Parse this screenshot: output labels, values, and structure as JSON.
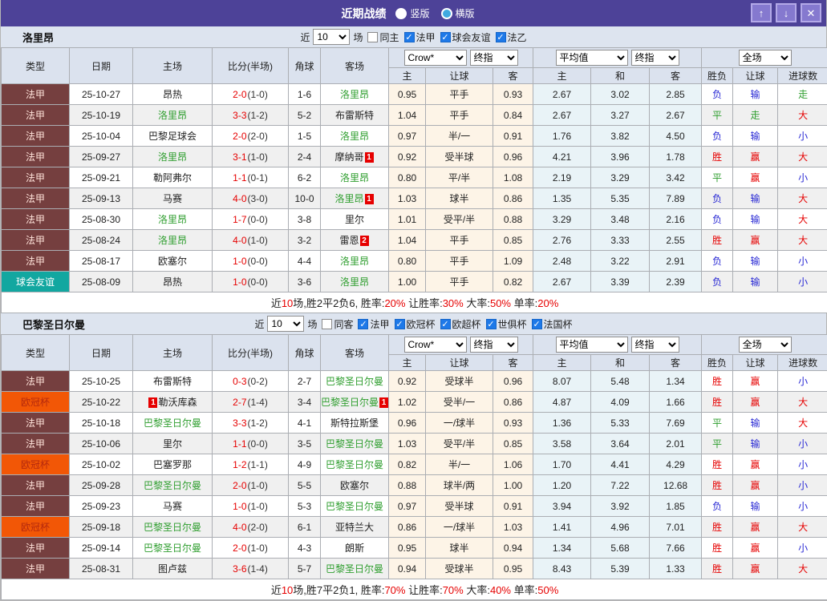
{
  "titlebar": {
    "title": "近期战绩",
    "radios": [
      {
        "label": "竖版",
        "selected": true
      },
      {
        "label": "横版",
        "selected": false
      }
    ],
    "buttons": {
      "up": "↑",
      "down": "↓",
      "close": "✕"
    }
  },
  "glyphs": {
    "check": "✓"
  },
  "colors": {
    "titlebar_bg": "#4d4298",
    "header_bg": "#dbe2ee",
    "handicap_col_bg": "#fdf4e7",
    "avg_col_bg": "#e9f3f7",
    "win_red": "#e60000",
    "draw_green": "#2f9e2f",
    "lose_blue": "#2727d4"
  },
  "type_styles": {
    "法甲": {
      "bg": "#753f3f",
      "fg": "#ffe3da"
    },
    "球会友谊": {
      "bg": "#12a7a0",
      "fg": "#ffffff"
    },
    "欧冠杯": {
      "bg": "#f25706",
      "fg": "#b5290e"
    }
  },
  "header_labels": {
    "type": "类型",
    "date": "日期",
    "home": "主场",
    "score": "比分(半场)",
    "corner": "角球",
    "away": "客场",
    "odds_select": "Crow*",
    "odds_select2": "终指",
    "avg_select": "平均值",
    "avg_select2": "终指",
    "result_select": "全场",
    "odds_sub": [
      "主",
      "让球",
      "客"
    ],
    "avg_sub": [
      "主",
      "和",
      "客"
    ],
    "result_sub": [
      "胜负",
      "让球",
      "进球数"
    ]
  },
  "sections": [
    {
      "team": "洛里昂",
      "filter": {
        "pre": "近",
        "count": "10",
        "post": "场",
        "same": {
          "label": "同主",
          "checked": false
        },
        "leagues": [
          {
            "label": "法甲",
            "checked": true
          },
          {
            "label": "球会友谊",
            "checked": true
          },
          {
            "label": "法乙",
            "checked": true
          }
        ]
      },
      "rows": [
        {
          "type": "法甲",
          "date": "25-10-27",
          "home": "昂热",
          "home_green": false,
          "ft": "2-0",
          "ht": "(1-0)",
          "corner": "1-6",
          "away": "洛里昂",
          "away_green": true,
          "odds": [
            "0.95",
            "平手",
            "0.93"
          ],
          "avg": [
            "2.67",
            "3.02",
            "2.85"
          ],
          "res": [
            [
              "负",
              "b"
            ],
            [
              "输",
              "b"
            ],
            [
              "走",
              "g"
            ]
          ]
        },
        {
          "type": "法甲",
          "date": "25-10-19",
          "home": "洛里昂",
          "home_green": true,
          "ft": "3-3",
          "ht": "(1-2)",
          "corner": "5-2",
          "away": "布雷斯特",
          "away_green": false,
          "odds": [
            "1.04",
            "平手",
            "0.84"
          ],
          "avg": [
            "2.67",
            "3.27",
            "2.67"
          ],
          "res": [
            [
              "平",
              "g"
            ],
            [
              "走",
              "g"
            ],
            [
              "大",
              "r"
            ]
          ]
        },
        {
          "type": "法甲",
          "date": "25-10-04",
          "home": "巴黎足球会",
          "home_green": false,
          "ft": "2-0",
          "ht": "(2-0)",
          "corner": "1-5",
          "away": "洛里昂",
          "away_green": true,
          "odds": [
            "0.97",
            "半/一",
            "0.91"
          ],
          "avg": [
            "1.76",
            "3.82",
            "4.50"
          ],
          "res": [
            [
              "负",
              "b"
            ],
            [
              "输",
              "b"
            ],
            [
              "小",
              "b"
            ]
          ]
        },
        {
          "type": "法甲",
          "date": "25-09-27",
          "home": "洛里昂",
          "home_green": true,
          "ft": "3-1",
          "ht": "(1-0)",
          "corner": "2-4",
          "away": "摩纳哥",
          "away_green": false,
          "away_badge_post": "1",
          "odds": [
            "0.92",
            "受半球",
            "0.96"
          ],
          "avg": [
            "4.21",
            "3.96",
            "1.78"
          ],
          "res": [
            [
              "胜",
              "r"
            ],
            [
              "赢",
              "r"
            ],
            [
              "大",
              "r"
            ]
          ]
        },
        {
          "type": "法甲",
          "date": "25-09-21",
          "home": "勒阿弗尔",
          "home_green": false,
          "ft": "1-1",
          "ht": "(0-1)",
          "corner": "6-2",
          "away": "洛里昂",
          "away_green": true,
          "odds": [
            "0.80",
            "平/半",
            "1.08"
          ],
          "avg": [
            "2.19",
            "3.29",
            "3.42"
          ],
          "res": [
            [
              "平",
              "g"
            ],
            [
              "赢",
              "r"
            ],
            [
              "小",
              "b"
            ]
          ]
        },
        {
          "type": "法甲",
          "date": "25-09-13",
          "home": "马赛",
          "home_green": false,
          "ft": "4-0",
          "ht": "(3-0)",
          "corner": "10-0",
          "away": "洛里昂",
          "away_green": true,
          "away_badge_post": "1",
          "odds": [
            "1.03",
            "球半",
            "0.86"
          ],
          "avg": [
            "1.35",
            "5.35",
            "7.89"
          ],
          "res": [
            [
              "负",
              "b"
            ],
            [
              "输",
              "b"
            ],
            [
              "大",
              "r"
            ]
          ]
        },
        {
          "type": "法甲",
          "date": "25-08-30",
          "home": "洛里昂",
          "home_green": true,
          "ft": "1-7",
          "ht": "(0-0)",
          "corner": "3-8",
          "away": "里尔",
          "away_green": false,
          "odds": [
            "1.01",
            "受平/半",
            "0.88"
          ],
          "avg": [
            "3.29",
            "3.48",
            "2.16"
          ],
          "res": [
            [
              "负",
              "b"
            ],
            [
              "输",
              "b"
            ],
            [
              "大",
              "r"
            ]
          ]
        },
        {
          "type": "法甲",
          "date": "25-08-24",
          "home": "洛里昂",
          "home_green": true,
          "ft": "4-0",
          "ht": "(1-0)",
          "corner": "3-2",
          "away": "雷恩",
          "away_green": false,
          "away_badge_post": "2",
          "odds": [
            "1.04",
            "平手",
            "0.85"
          ],
          "avg": [
            "2.76",
            "3.33",
            "2.55"
          ],
          "res": [
            [
              "胜",
              "r"
            ],
            [
              "赢",
              "r"
            ],
            [
              "大",
              "r"
            ]
          ]
        },
        {
          "type": "法甲",
          "date": "25-08-17",
          "home": "欧塞尔",
          "home_green": false,
          "ft": "1-0",
          "ht": "(0-0)",
          "corner": "4-4",
          "away": "洛里昂",
          "away_green": true,
          "odds": [
            "0.80",
            "平手",
            "1.09"
          ],
          "avg": [
            "2.48",
            "3.22",
            "2.91"
          ],
          "res": [
            [
              "负",
              "b"
            ],
            [
              "输",
              "b"
            ],
            [
              "小",
              "b"
            ]
          ]
        },
        {
          "type": "球会友谊",
          "date": "25-08-09",
          "home": "昂热",
          "home_green": false,
          "ft": "1-0",
          "ht": "(0-0)",
          "corner": "3-6",
          "away": "洛里昂",
          "away_green": true,
          "odds": [
            "1.00",
            "平手",
            "0.82"
          ],
          "avg": [
            "2.67",
            "3.39",
            "2.39"
          ],
          "res": [
            [
              "负",
              "b"
            ],
            [
              "输",
              "b"
            ],
            [
              "小",
              "b"
            ]
          ]
        }
      ],
      "summary": [
        [
          "近",
          "k"
        ],
        [
          "10",
          "r"
        ],
        [
          "场,胜2平2负6, 胜率:",
          "k"
        ],
        [
          "20%",
          "r"
        ],
        [
          " 让胜率:",
          "k"
        ],
        [
          "30%",
          "r"
        ],
        [
          " 大率:",
          "k"
        ],
        [
          "50%",
          "r"
        ],
        [
          " 单率:",
          "k"
        ],
        [
          "20%",
          "r"
        ]
      ]
    },
    {
      "team": "巴黎圣日尔曼",
      "filter": {
        "pre": "近",
        "count": "10",
        "post": "场",
        "same": {
          "label": "同客",
          "checked": false
        },
        "leagues": [
          {
            "label": "法甲",
            "checked": true
          },
          {
            "label": "欧冠杯",
            "checked": true
          },
          {
            "label": "欧超杯",
            "checked": true
          },
          {
            "label": "世俱杯",
            "checked": true
          },
          {
            "label": "法国杯",
            "checked": true
          }
        ]
      },
      "rows": [
        {
          "type": "法甲",
          "date": "25-10-25",
          "home": "布雷斯特",
          "home_green": false,
          "ft": "0-3",
          "ht": "(0-2)",
          "corner": "2-7",
          "away": "巴黎圣日尔曼",
          "away_green": true,
          "odds": [
            "0.92",
            "受球半",
            "0.96"
          ],
          "avg": [
            "8.07",
            "5.48",
            "1.34"
          ],
          "res": [
            [
              "胜",
              "r"
            ],
            [
              "赢",
              "r"
            ],
            [
              "小",
              "b"
            ]
          ]
        },
        {
          "type": "欧冠杯",
          "date": "25-10-22",
          "home": "勒沃库森",
          "home_green": false,
          "home_badge_pre": "1",
          "ft": "2-7",
          "ht": "(1-4)",
          "corner": "3-4",
          "away": "巴黎圣日尔曼",
          "away_green": true,
          "away_badge_post": "1",
          "odds": [
            "1.02",
            "受半/一",
            "0.86"
          ],
          "avg": [
            "4.87",
            "4.09",
            "1.66"
          ],
          "res": [
            [
              "胜",
              "r"
            ],
            [
              "赢",
              "r"
            ],
            [
              "大",
              "r"
            ]
          ]
        },
        {
          "type": "法甲",
          "date": "25-10-18",
          "home": "巴黎圣日尔曼",
          "home_green": true,
          "ft": "3-3",
          "ht": "(1-2)",
          "corner": "4-1",
          "away": "斯特拉斯堡",
          "away_green": false,
          "odds": [
            "0.96",
            "一/球半",
            "0.93"
          ],
          "avg": [
            "1.36",
            "5.33",
            "7.69"
          ],
          "res": [
            [
              "平",
              "g"
            ],
            [
              "输",
              "b"
            ],
            [
              "大",
              "r"
            ]
          ]
        },
        {
          "type": "法甲",
          "date": "25-10-06",
          "home": "里尔",
          "home_green": false,
          "ft": "1-1",
          "ht": "(0-0)",
          "corner": "3-5",
          "away": "巴黎圣日尔曼",
          "away_green": true,
          "odds": [
            "1.03",
            "受平/半",
            "0.85"
          ],
          "avg": [
            "3.58",
            "3.64",
            "2.01"
          ],
          "res": [
            [
              "平",
              "g"
            ],
            [
              "输",
              "b"
            ],
            [
              "小",
              "b"
            ]
          ]
        },
        {
          "type": "欧冠杯",
          "date": "25-10-02",
          "home": "巴塞罗那",
          "home_green": false,
          "ft": "1-2",
          "ht": "(1-1)",
          "corner": "4-9",
          "away": "巴黎圣日尔曼",
          "away_green": true,
          "odds": [
            "0.82",
            "半/一",
            "1.06"
          ],
          "avg": [
            "1.70",
            "4.41",
            "4.29"
          ],
          "res": [
            [
              "胜",
              "r"
            ],
            [
              "赢",
              "r"
            ],
            [
              "小",
              "b"
            ]
          ]
        },
        {
          "type": "法甲",
          "date": "25-09-28",
          "home": "巴黎圣日尔曼",
          "home_green": true,
          "ft": "2-0",
          "ht": "(1-0)",
          "corner": "5-5",
          "away": "欧塞尔",
          "away_green": false,
          "odds": [
            "0.88",
            "球半/两",
            "1.00"
          ],
          "avg": [
            "1.20",
            "7.22",
            "12.68"
          ],
          "res": [
            [
              "胜",
              "r"
            ],
            [
              "赢",
              "r"
            ],
            [
              "小",
              "b"
            ]
          ]
        },
        {
          "type": "法甲",
          "date": "25-09-23",
          "home": "马赛",
          "home_green": false,
          "ft": "1-0",
          "ht": "(1-0)",
          "corner": "5-3",
          "away": "巴黎圣日尔曼",
          "away_green": true,
          "odds": [
            "0.97",
            "受半球",
            "0.91"
          ],
          "avg": [
            "3.94",
            "3.92",
            "1.85"
          ],
          "res": [
            [
              "负",
              "b"
            ],
            [
              "输",
              "b"
            ],
            [
              "小",
              "b"
            ]
          ]
        },
        {
          "type": "欧冠杯",
          "date": "25-09-18",
          "home": "巴黎圣日尔曼",
          "home_green": true,
          "ft": "4-0",
          "ht": "(2-0)",
          "corner": "6-1",
          "away": "亚特兰大",
          "away_green": false,
          "odds": [
            "0.86",
            "一/球半",
            "1.03"
          ],
          "avg": [
            "1.41",
            "4.96",
            "7.01"
          ],
          "res": [
            [
              "胜",
              "r"
            ],
            [
              "赢",
              "r"
            ],
            [
              "大",
              "r"
            ]
          ]
        },
        {
          "type": "法甲",
          "date": "25-09-14",
          "home": "巴黎圣日尔曼",
          "home_green": true,
          "ft": "2-0",
          "ht": "(1-0)",
          "corner": "4-3",
          "away": "朗斯",
          "away_green": false,
          "odds": [
            "0.95",
            "球半",
            "0.94"
          ],
          "avg": [
            "1.34",
            "5.68",
            "7.66"
          ],
          "res": [
            [
              "胜",
              "r"
            ],
            [
              "赢",
              "r"
            ],
            [
              "小",
              "b"
            ]
          ]
        },
        {
          "type": "法甲",
          "date": "25-08-31",
          "home": "图卢兹",
          "home_green": false,
          "ft": "3-6",
          "ht": "(1-4)",
          "corner": "5-7",
          "away": "巴黎圣日尔曼",
          "away_green": true,
          "odds": [
            "0.94",
            "受球半",
            "0.95"
          ],
          "avg": [
            "8.43",
            "5.39",
            "1.33"
          ],
          "res": [
            [
              "胜",
              "r"
            ],
            [
              "赢",
              "r"
            ],
            [
              "大",
              "r"
            ]
          ]
        }
      ],
      "summary": [
        [
          "近",
          "k"
        ],
        [
          "10",
          "r"
        ],
        [
          "场,胜7平2负1, 胜率:",
          "k"
        ],
        [
          "70%",
          "r"
        ],
        [
          " 让胜率:",
          "k"
        ],
        [
          "70%",
          "r"
        ],
        [
          " 大率:",
          "k"
        ],
        [
          "40%",
          "r"
        ],
        [
          " 单率:",
          "k"
        ],
        [
          "50%",
          "r"
        ]
      ]
    }
  ]
}
